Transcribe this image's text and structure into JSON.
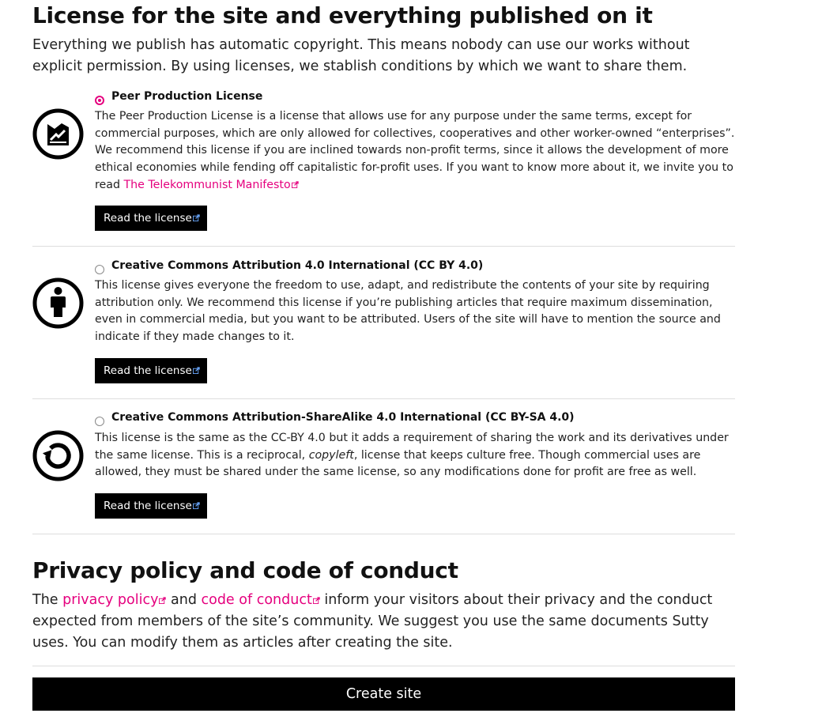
{
  "license_section": {
    "title": "License for the site and everything published on it",
    "lead": "Everything we publish has automatic copyright. This means nobody can use our works without explicit permission. By using licenses, we stablish conditions by which we want to share them."
  },
  "licenses": [
    {
      "name": "Peer Production License",
      "icon": "peer-production-icon",
      "selected": true,
      "description": "The Peer Production License is a license that allows use for any purpose under the same terms, except for commercial purposes, which are only allowed for collectives, cooperatives and other worker-owned “enter­prises”. We recommend this license if you are inclined towards non-profit terms, since it allows the development of more ethical economies while fending off capitalistic for-profit uses. If you want to know more about it, we invite you to read ",
      "link_text": "The Telekommunist Manifesto",
      "button_label": "Read the license"
    },
    {
      "name": "Creative Commons Attribution 4.0 International (CC BY 4.0)",
      "icon": "cc-attribution-icon",
      "selected": false,
      "description": "This license gives everyone the freedom to use, adapt, and redistribute the contents of your site by requiring attribution only. We recommend this license if you’re publishing articles that require maximum dissemination, even in commercial media, but you want to be attributed. Users of the site will have to mention the source and indicate if they made changes to it.",
      "button_label": "Read the license"
    },
    {
      "name": "Creative Commons Attribution-ShareAlike 4.0 International (CC BY-SA 4.0)",
      "icon": "cc-sharealike-icon",
      "selected": false,
      "description_before": "This license is the same as the CC-BY 4.0 but it adds a requirement of sharing the work and its derivatives under the same license. This is a reciprocal, ",
      "description_em": "copyleft",
      "description_after": ", license that keeps culture free. Though commercial uses are allowed, they must be shared under the same license, so any modifications done for profit are free as well.",
      "button_label": "Read the license"
    }
  ],
  "privacy_section": {
    "title": "Privacy policy and code of conduct",
    "text_the": "The ",
    "privacy_link": "privacy policy",
    "text_and": " and ",
    "conduct_link": "code of conduct",
    "text_rest": " inform your visitors about their privacy and the conduct expected from members of the site’s community. We suggest you use the same documents Sutty uses. You can modify them as articles after creating the site."
  },
  "create_button_label": "Create site",
  "colors": {
    "accent": "#e5007e",
    "button_bg": "#000000",
    "divider": "#dddddd"
  }
}
